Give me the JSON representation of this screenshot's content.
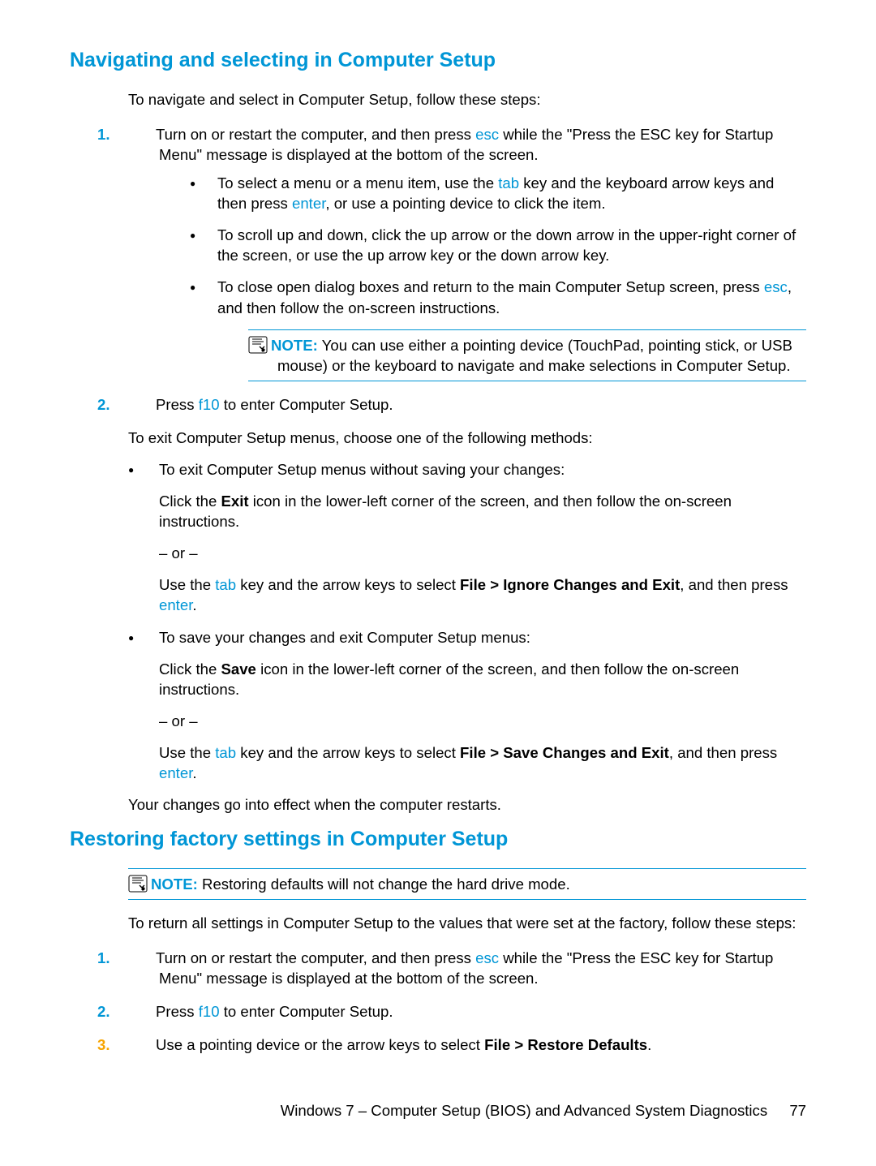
{
  "h1": "Navigating and selecting in Computer Setup",
  "intro1": "To navigate and select in Computer Setup, follow these steps:",
  "step1_pre": "Turn on or restart the computer, and then press ",
  "key_esc": "esc",
  "step1_post": " while the \"Press the ESC key for Startup Menu\" message is displayed at the bottom of the screen.",
  "sub1_pre": "To select a menu or a menu item, use the ",
  "key_tab": "tab",
  "sub1_mid": " key and the keyboard arrow keys and then press ",
  "key_enter": "enter",
  "sub1_post": ", or use a pointing device to click the item.",
  "sub2": "To scroll up and down, click the up arrow or the down arrow in the upper-right corner of the screen, or use the up arrow key or the down arrow key.",
  "sub3_pre": "To close open dialog boxes and return to the main Computer Setup screen, press ",
  "sub3_post": ", and then follow the on-screen instructions.",
  "note_label": "NOTE:",
  "note1_body": " You can use either a pointing device (TouchPad, pointing stick, or USB mouse) or the keyboard to navigate and make selections in Computer Setup.",
  "step2_pre": "Press ",
  "key_f10": "f10",
  "step2_post": " to enter Computer Setup.",
  "exit_intro": "To exit Computer Setup menus, choose one of the following methods:",
  "exit_b1": "To exit Computer Setup menus without saving your changes:",
  "exit_b1_p1_pre": "Click the ",
  "exit_b1_p1_bold": "Exit",
  "exit_b1_p1_post": " icon in the lower-left corner of the screen, and then follow the on-screen instructions.",
  "or_dash": "– or –",
  "exit_b1_p2_pre": "Use the ",
  "exit_b1_p2_mid": " key and the arrow keys to select ",
  "exit_b1_p2_bold": "File > Ignore Changes and Exit",
  "exit_b1_p2_post": ", and then press ",
  "period": ".",
  "exit_b2": "To save your changes and exit Computer Setup menus:",
  "exit_b2_p1_pre": "Click the ",
  "exit_b2_p1_bold": "Save",
  "exit_b2_p1_post": " icon in the lower-left corner of the screen, and then follow the on-screen instructions.",
  "exit_b2_p2_pre": "Use the ",
  "exit_b2_p2_mid": " key and the arrow keys to select ",
  "exit_b2_p2_bold": "File > Save Changes and Exit",
  "exit_b2_p2_post": ", and then press ",
  "effect": "Your changes go into effect when the computer restarts.",
  "h2": "Restoring factory settings in Computer Setup",
  "note2_body": " Restoring defaults will not change the hard drive mode.",
  "restore_intro": "To return all settings in Computer Setup to the values that were set at the factory, follow these steps:",
  "r_step1_pre": "Turn on or restart the computer, and then press ",
  "r_step1_post": " while the \"Press the ESC key for Startup Menu\" message is displayed at the bottom of the screen.",
  "r_step2_pre": "Press ",
  "r_step2_post": " to enter Computer Setup.",
  "r_step3_pre": "Use a pointing device or the arrow keys to select ",
  "r_step3_bold": "File > Restore Defaults",
  "footer_text": "Windows 7 – Computer Setup (BIOS) and Advanced System Diagnostics",
  "page_num": "77",
  "step_nums": {
    "s1": "1.",
    "s2": "2.",
    "s3": "3."
  }
}
